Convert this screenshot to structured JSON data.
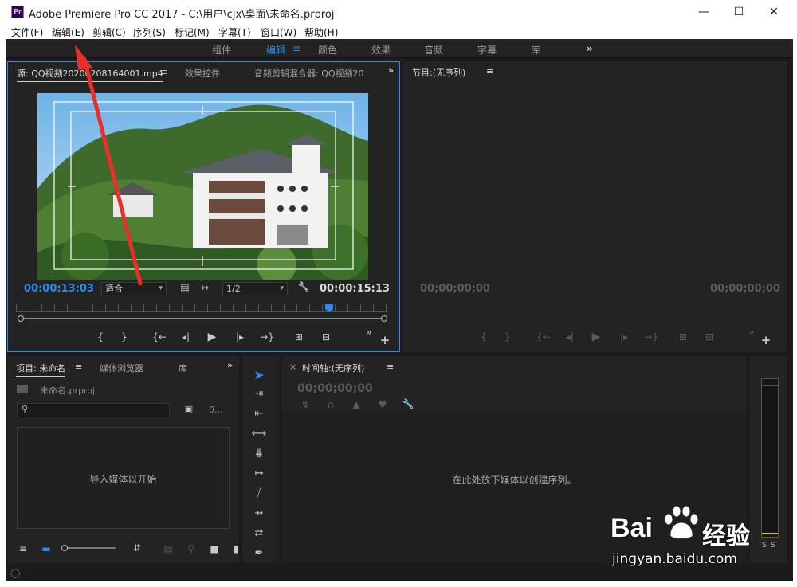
{
  "window": {
    "title": "Adobe Premiere Pro CC 2017 - C:\\用户\\cjx\\桌面\\未命名.prproj",
    "logo_text": "Pr",
    "minimize": "—",
    "maximize": "☐",
    "close": "✕"
  },
  "menu": [
    "文件(F)",
    "编辑(E)",
    "剪辑(C)",
    "序列(S)",
    "标记(M)",
    "字幕(T)",
    "窗口(W)",
    "帮助(H)"
  ],
  "workspaces": {
    "tabs": [
      "组件",
      "编辑",
      "颜色",
      "效果",
      "音频",
      "字幕",
      "库"
    ],
    "active_menu_icon": "≡",
    "overflow": "»"
  },
  "source_panel": {
    "tabs": [
      "源: QQ视频20200208164001.mp4",
      "效果控件",
      "音频剪辑混合器: QQ视频20"
    ],
    "tab_menu": "≡",
    "overflow": "»",
    "timecode_current": "00:00:13:03",
    "timecode_duration": "00:00:15:13",
    "fit_select": "适合",
    "resolution_select": "1/2",
    "controls": [
      "{",
      "}",
      "{←",
      "◂|",
      "▶",
      "|▸",
      "→}",
      "⊞",
      "⊟"
    ],
    "add": "+",
    "more": "»"
  },
  "program_panel": {
    "tab": "节目:(无序列)",
    "tab_menu": "≡",
    "timecode_left": "00;00;00;00",
    "timecode_right": "00;00;00;00",
    "controls": [
      "{",
      "}",
      "{←",
      "◂|",
      "▶",
      "|▸",
      "→}",
      "⊞",
      "⊟"
    ],
    "add": "+",
    "more": "»"
  },
  "project_panel": {
    "tabs": [
      "项目: 未命名",
      "媒体浏览器",
      "库"
    ],
    "tab_menu": "≡",
    "overflow": "»",
    "file_name": "未命名.prproj",
    "search_placeholder": "",
    "item_count": "0...",
    "empty_message": "导入媒体以开始"
  },
  "timeline_panel": {
    "close": "×",
    "tab": "时间轴:(无序列)",
    "tab_menu": "≡",
    "timecode": "00;00;00;00",
    "empty_message": "在此处放下媒体以创建序列。"
  },
  "meter": {
    "labels": [
      "S",
      "S"
    ]
  },
  "watermark": {
    "brand_left": "Bai",
    "brand_right": "经验",
    "url": "jingyan.baidu.com"
  },
  "colors": {
    "accent": "#2d8ceb",
    "panel_bg": "#232323",
    "arrow": "#e8302a"
  }
}
